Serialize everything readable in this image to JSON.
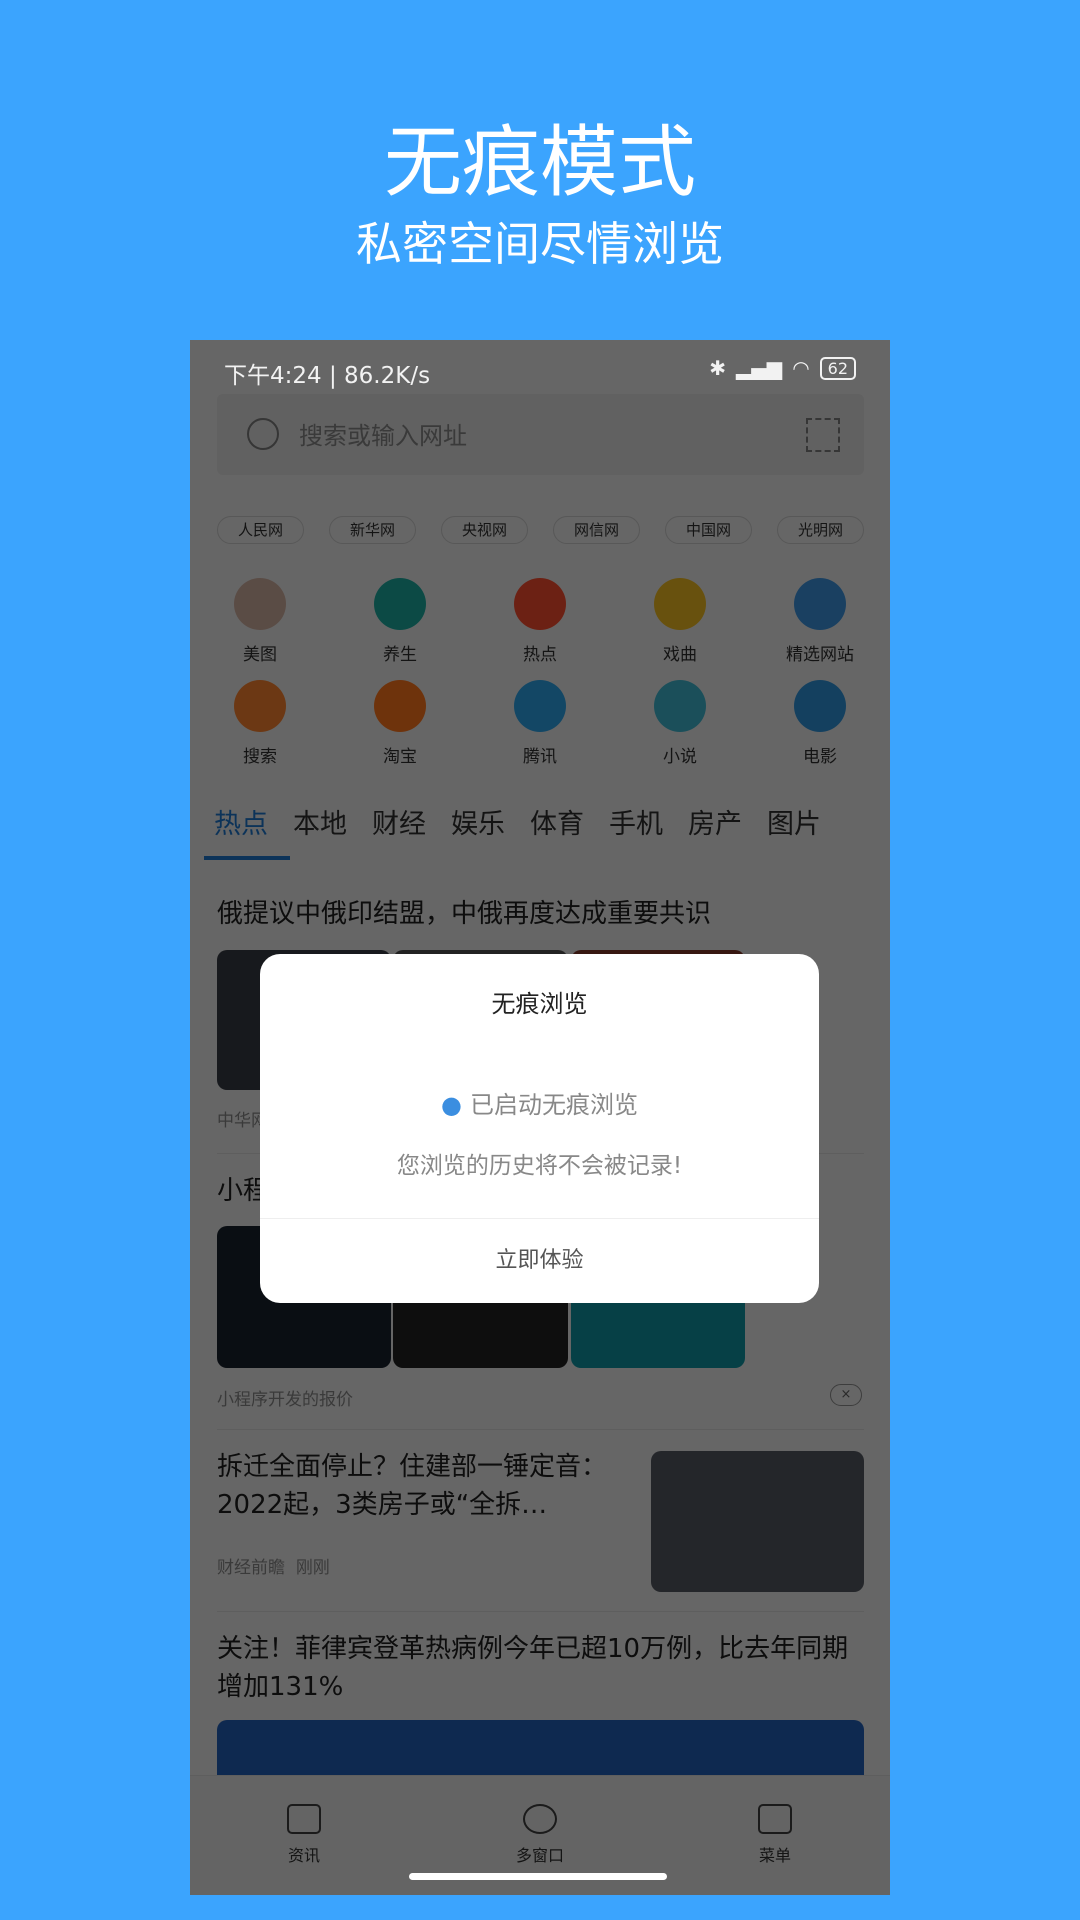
{
  "hero": {
    "title": "无痕模式",
    "subtitle": "私密空间尽情浏览"
  },
  "status_bar": {
    "time": "下午4:24 | 86.2K/s",
    "battery": "62"
  },
  "search": {
    "placeholder": "搜索或输入网址"
  },
  "chips": [
    "人民网",
    "新华网",
    "央视网",
    "网信网",
    "中国网",
    "光明网"
  ],
  "grid": [
    {
      "label": "美图",
      "color": "#c9a89a"
    },
    {
      "label": "养生",
      "color": "#1aa59a"
    },
    {
      "label": "热点",
      "color": "#f04a2c"
    },
    {
      "label": "戏曲",
      "color": "#e8b41e"
    },
    {
      "label": "精选网站",
      "color": "#3a8fd8"
    },
    {
      "label": "搜索",
      "color": "#f07d2c"
    },
    {
      "label": "淘宝",
      "color": "#f5711b"
    },
    {
      "label": "腾讯",
      "color": "#2a9ee0"
    },
    {
      "label": "小说",
      "color": "#3bb0c9"
    },
    {
      "label": "电影",
      "color": "#2d8fd4"
    }
  ],
  "tabs": [
    "热点",
    "本地",
    "财经",
    "娱乐",
    "体育",
    "手机",
    "房产",
    "图片"
  ],
  "feed": {
    "a1_title": "俄提议中俄印结盟，中俄再度达成重要共识",
    "a1_source": "中华网",
    "a2_title": "小程",
    "a2_caption": "小程序开发的报价",
    "a3_title": "拆迁全面停止？住建部一锤定音：2022起，3类房子或“全拆…",
    "a3_source": "财经前瞻",
    "a3_time": "刚刚",
    "a4_title": "关注！菲律宾登革热病例今年已超10万例，比去年同期增加131%"
  },
  "bottom_nav": [
    {
      "label": "资讯",
      "icon": "book-icon"
    },
    {
      "label": "多窗口",
      "icon": "windows-icon"
    },
    {
      "label": "菜单",
      "icon": "menu-grid-icon"
    }
  ],
  "modal": {
    "title": "无痕浏览",
    "line1": "已启动无痕浏览",
    "line2": "您浏览的历史将不会被记录!",
    "button": "立即体验"
  },
  "colors": {
    "background": "#3ba4fe",
    "accent": "#1d7fe0"
  }
}
